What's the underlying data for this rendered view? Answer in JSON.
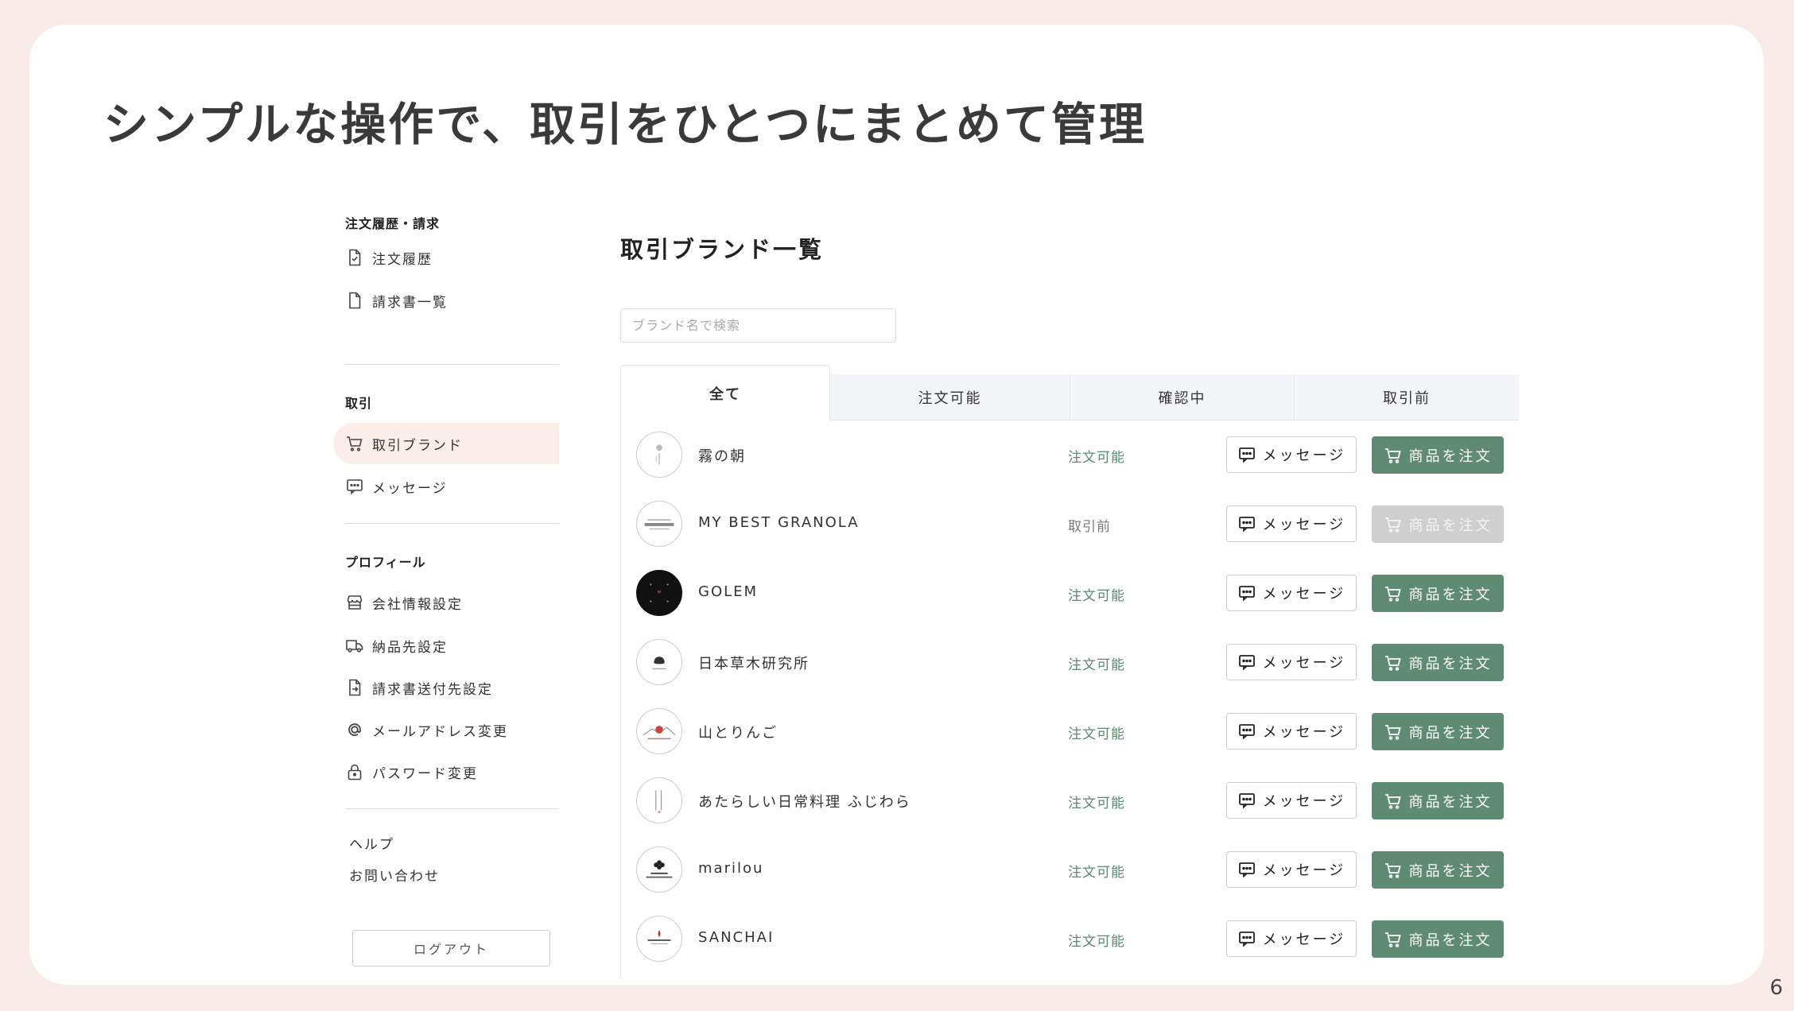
{
  "headline": "シンプルな操作で、取引をひとつにまとめて管理",
  "page_number": "6",
  "sidebar": {
    "sections": {
      "orders": {
        "title": "注文履歴・請求",
        "items": [
          {
            "label": "注文履歴",
            "icon": "order-history-icon"
          },
          {
            "label": "請求書一覧",
            "icon": "invoice-icon"
          }
        ]
      },
      "trade": {
        "title": "取引",
        "items": [
          {
            "label": "取引ブランド",
            "icon": "cart-icon",
            "active": true
          },
          {
            "label": "メッセージ",
            "icon": "message-icon"
          }
        ]
      },
      "profile": {
        "title": "プロフィール",
        "items": [
          {
            "label": "会社情報設定",
            "icon": "store-icon"
          },
          {
            "label": "納品先設定",
            "icon": "truck-icon"
          },
          {
            "label": "請求書送付先設定",
            "icon": "invoice-send-icon"
          },
          {
            "label": "メールアドレス変更",
            "icon": "at-icon"
          },
          {
            "label": "パスワード変更",
            "icon": "lock-icon"
          }
        ]
      }
    },
    "help": "ヘルプ",
    "contact": "お問い合わせ",
    "logout": "ログアウト"
  },
  "main": {
    "title": "取引ブランド一覧",
    "search_placeholder": "ブランド名で検索",
    "tabs": [
      "全て",
      "注文可能",
      "確認中",
      "取引前"
    ],
    "active_tab": "全て",
    "message_label": "メッセージ",
    "order_label": "商品を注文",
    "rows": [
      {
        "name": "霧の朝",
        "status": "注文可能",
        "orderable": true
      },
      {
        "name": "MY BEST GRANOLA",
        "status": "取引前",
        "orderable": false
      },
      {
        "name": "GOLEM",
        "status": "注文可能",
        "orderable": true
      },
      {
        "name": "日本草木研究所",
        "status": "注文可能",
        "orderable": true
      },
      {
        "name": "山とりんご",
        "status": "注文可能",
        "orderable": true
      },
      {
        "name": "あたらしい日常料理 ふじわら",
        "status": "注文可能",
        "orderable": true
      },
      {
        "name": "marilou",
        "status": "注文可能",
        "orderable": true
      },
      {
        "name": "SANCHAI",
        "status": "注文可能",
        "orderable": true
      }
    ]
  },
  "colors": {
    "background": "#f9ece6",
    "accent_green": "#5f8b72",
    "status_green": "#5a8a6e",
    "active_nav": "#fbeee8",
    "disabled": "#cfcfcf"
  }
}
